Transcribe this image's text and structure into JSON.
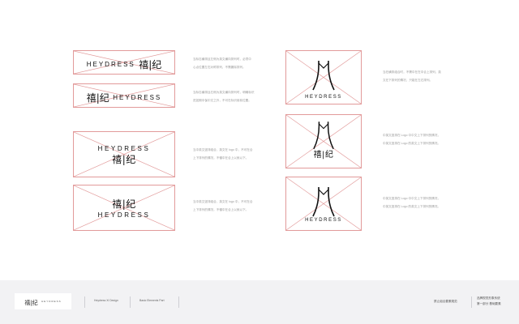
{
  "brand": {
    "english": "HEYDRESS",
    "chinese": "禧|纪",
    "divider": "|"
  },
  "descriptions": {
    "a": [
      "当标志横排且左侧为英文横向排列时，必须中",
      "心点位置左右对称排列，不需撇除排列。"
    ],
    "b": [
      "当标志横排且右侧为英文横向排列时，明确标识",
      "进如期中保中文之外，不可在标识用前位置。"
    ],
    "c": [
      "当中英文竖排组合，英文在 logo 中，不可在合",
      "上下排列的情况，不懂中在合上以就以下。"
    ],
    "d": [
      "当中英文竖排组合，英文在 logo 中，不可在合",
      "上下排列的情况，不懂中在合上以就以下。"
    ],
    "e": [
      "当在横排组合时，不需中在在中合上排列，英",
      "文在下排列的情况，只能在左右排列。"
    ],
    "f": [
      "中英文竖排在 Logo 中中文上下排列的情况，",
      "中英文竖排在 Logo 的英文上下排列的情况。"
    ],
    "g": [
      "中英文竖排在 Logo 中中文上下排列的情况，",
      "中英文竖排在 Logo 的英文上下排列的情况。"
    ]
  },
  "footer": {
    "logo_cn": "禧|纪",
    "logo_en": "HEYDRESS",
    "item1": "Heydress Xi Design",
    "item2": "Basic Elements Part",
    "section": "禁止组合要素规范",
    "right_line1": "品牌视觉形象系统",
    "right_line2": "第一部分 基础要素"
  },
  "colors": {
    "guide_line": "#e29a9a",
    "footer_bg": "#f2f2f4"
  }
}
